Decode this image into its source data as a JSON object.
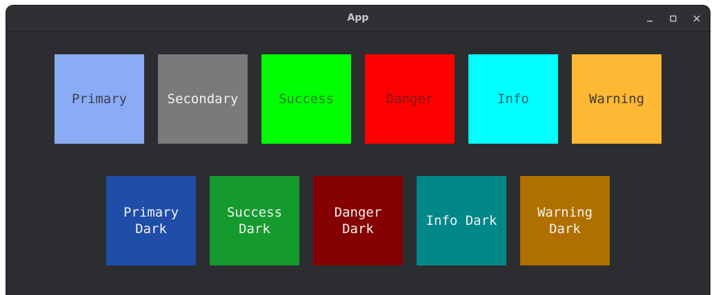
{
  "window": {
    "title": "App"
  },
  "colors": {
    "primary": "#8aacf4",
    "secondary": "#7a7a7a",
    "success": "#00ff00",
    "danger": "#ff0000",
    "info": "#00ffff",
    "warning": "#ffb833",
    "primary_dark": "#1f4da8",
    "success_dark": "#159a2d",
    "danger_dark": "#850000",
    "info_dark": "#008888",
    "warning_dark": "#b07000"
  },
  "tiles_row1": [
    {
      "label": "Primary"
    },
    {
      "label": "Secondary"
    },
    {
      "label": "Success"
    },
    {
      "label": "Danger"
    },
    {
      "label": "Info"
    },
    {
      "label": "Warning"
    }
  ],
  "tiles_row2": [
    {
      "label": "Primary\nDark"
    },
    {
      "label": "Success\nDark"
    },
    {
      "label": "Danger\nDark"
    },
    {
      "label": "Info Dark"
    },
    {
      "label": "Warning\nDark"
    }
  ]
}
